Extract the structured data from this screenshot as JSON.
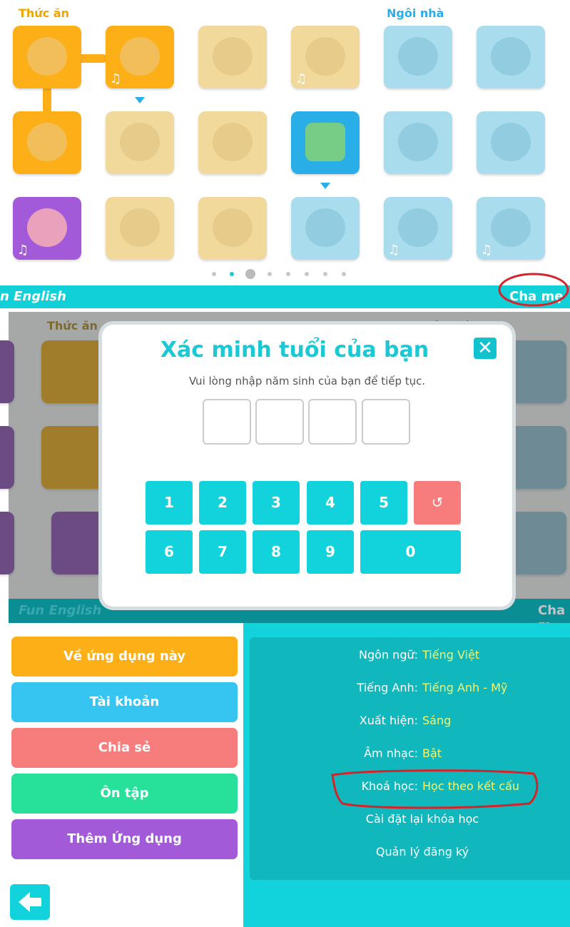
{
  "top": {
    "category_left": "Thức ăn",
    "category_right": "Ngôi nhà",
    "bar_left": "n English",
    "bar_right": "Cha mẹ"
  },
  "dimmed": {
    "category_left": "Thức ăn",
    "category_right": "Ngôi nhà",
    "bar_left": "Fun English",
    "bar_right": "Cha m"
  },
  "modal": {
    "title": "Xác minh tuổi của bạn",
    "subtitle": "Vui lòng nhập năm sinh của bạn để tiếp tục.",
    "close_icon": "close-icon",
    "keys": [
      "1",
      "2",
      "3",
      "4",
      "5",
      "↺",
      "6",
      "7",
      "8",
      "9",
      "0"
    ]
  },
  "menu": {
    "items": [
      "Về ứng dụng này",
      "Tài khoản",
      "Chia sẻ",
      "Ôn tập",
      "Thêm Ứng dụng"
    ],
    "colors": [
      "#fcaf17",
      "#36c5f0",
      "#f77d7d",
      "#27e09a",
      "#a25ad9"
    ],
    "back_icon": "back-arrow-icon"
  },
  "settings": {
    "rows": [
      {
        "key": "Ngôn ngữ:",
        "value": "Tiếng Việt"
      },
      {
        "key": "Tiếng Anh:",
        "value": "Tiếng Anh - Mỹ"
      },
      {
        "key": "Xuất hiện:",
        "value": "Sáng"
      },
      {
        "key": "Âm nhạc:",
        "value": "Bật"
      },
      {
        "key": "Khoá học:",
        "value": "Học theo kết cấu"
      }
    ],
    "actions": [
      "Cài đặt lại khóa học",
      "Quản lý đăng ký"
    ]
  },
  "colors": {
    "accent": "#11d0d8",
    "annotation": "#d6232a"
  }
}
